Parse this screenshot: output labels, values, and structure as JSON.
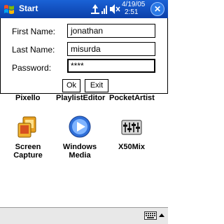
{
  "titlebar": {
    "title": "Start",
    "date": "4/19/05",
    "time": "2:51"
  },
  "dialog": {
    "first_name_label": "First Name:",
    "first_name_value": "jonathan",
    "last_name_label": "Last Name:",
    "last_name_value": "misurda",
    "password_label": "Password:",
    "password_value": "****",
    "ok_label": "Ok",
    "exit_label": "Exit"
  },
  "desktop": {
    "partial_labels": [
      "Pixello",
      "PlaylistEditor",
      "PocketArtist"
    ],
    "apps": [
      {
        "name_line1": "Screen",
        "name_line2": "Capture",
        "icon": "screen-capture-icon"
      },
      {
        "name_line1": "Windows",
        "name_line2": "Media",
        "icon": "windows-media-icon"
      },
      {
        "name_line1": "X50Mix",
        "name_line2": "",
        "icon": "x50mix-icon"
      }
    ]
  },
  "colors": {
    "titlebar": "#0b3fa8",
    "accent": "#1a62d6"
  }
}
